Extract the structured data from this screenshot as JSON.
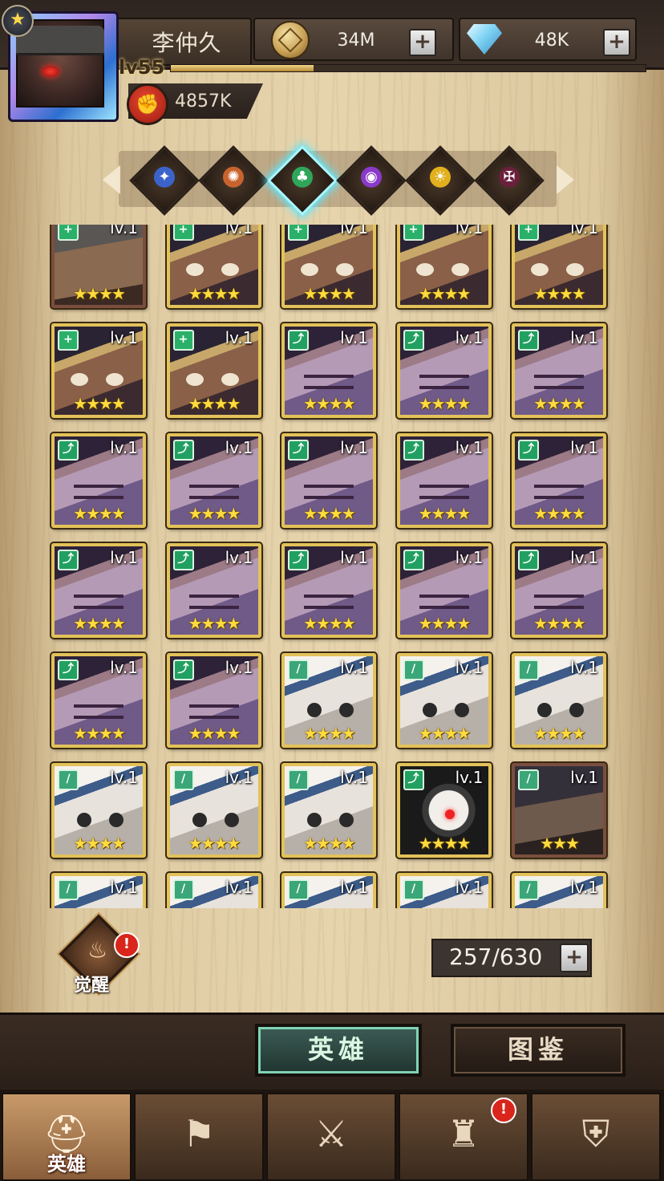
{
  "player": {
    "name": "李仲久",
    "level": "lv55",
    "xp_fraction": 0.3,
    "power": "4857K"
  },
  "currency": {
    "gold": "34M",
    "gems": "48K",
    "plus_symbol": "+"
  },
  "element_filters": [
    {
      "name": "light",
      "color": "#3b63c9",
      "glyph": "✦"
    },
    {
      "name": "fire",
      "color": "#c9632e",
      "glyph": "✺"
    },
    {
      "name": "nature",
      "color": "#2fa65a",
      "glyph": "♣",
      "active": true
    },
    {
      "name": "shadow",
      "color": "#8a3ac9",
      "glyph": "◉"
    },
    {
      "name": "sun",
      "color": "#e2b01e",
      "glyph": "☀"
    },
    {
      "name": "dark",
      "color": "#6a1f3a",
      "glyph": "✠"
    }
  ],
  "heroes": [
    {
      "portrait": "helmet",
      "class": "support",
      "level": "lv.1",
      "stars": "★★★★",
      "quality": "bronze"
    },
    {
      "portrait": "horn",
      "class": "support",
      "level": "lv.1",
      "stars": "★★★★"
    },
    {
      "portrait": "horn",
      "class": "support",
      "level": "lv.1",
      "stars": "★★★★"
    },
    {
      "portrait": "horn",
      "class": "support",
      "level": "lv.1",
      "stars": "★★★★"
    },
    {
      "portrait": "horn",
      "class": "support",
      "level": "lv.1",
      "stars": "★★★★"
    },
    {
      "portrait": "horn",
      "class": "support",
      "level": "lv.1",
      "stars": "★★★★"
    },
    {
      "portrait": "horn",
      "class": "support",
      "level": "lv.1",
      "stars": "★★★★"
    },
    {
      "portrait": "purple",
      "class": "ranger",
      "level": "lv.1",
      "stars": "★★★★"
    },
    {
      "portrait": "purple",
      "class": "ranger",
      "level": "lv.1",
      "stars": "★★★★"
    },
    {
      "portrait": "purple",
      "class": "ranger",
      "level": "lv.1",
      "stars": "★★★★"
    },
    {
      "portrait": "purple",
      "class": "ranger",
      "level": "lv.1",
      "stars": "★★★★"
    },
    {
      "portrait": "purple",
      "class": "ranger",
      "level": "lv.1",
      "stars": "★★★★"
    },
    {
      "portrait": "purple",
      "class": "ranger",
      "level": "lv.1",
      "stars": "★★★★"
    },
    {
      "portrait": "purple",
      "class": "ranger",
      "level": "lv.1",
      "stars": "★★★★"
    },
    {
      "portrait": "purple",
      "class": "ranger",
      "level": "lv.1",
      "stars": "★★★★"
    },
    {
      "portrait": "purple",
      "class": "ranger",
      "level": "lv.1",
      "stars": "★★★★"
    },
    {
      "portrait": "purple",
      "class": "ranger",
      "level": "lv.1",
      "stars": "★★★★"
    },
    {
      "portrait": "purple",
      "class": "ranger",
      "level": "lv.1",
      "stars": "★★★★"
    },
    {
      "portrait": "purple",
      "class": "ranger",
      "level": "lv.1",
      "stars": "★★★★"
    },
    {
      "portrait": "purple",
      "class": "ranger",
      "level": "lv.1",
      "stars": "★★★★"
    },
    {
      "portrait": "purple",
      "class": "ranger",
      "level": "lv.1",
      "stars": "★★★★"
    },
    {
      "portrait": "purple",
      "class": "ranger",
      "level": "lv.1",
      "stars": "★★★★"
    },
    {
      "portrait": "white",
      "class": "rogue",
      "level": "lv.1",
      "stars": "★★★★"
    },
    {
      "portrait": "white",
      "class": "rogue",
      "level": "lv.1",
      "stars": "★★★★"
    },
    {
      "portrait": "white",
      "class": "rogue",
      "level": "lv.1",
      "stars": "★★★★"
    },
    {
      "portrait": "white",
      "class": "rogue",
      "level": "lv.1",
      "stars": "★★★★"
    },
    {
      "portrait": "white",
      "class": "rogue",
      "level": "lv.1",
      "stars": "★★★★"
    },
    {
      "portrait": "white",
      "class": "rogue",
      "level": "lv.1",
      "stars": "★★★★"
    },
    {
      "portrait": "skull",
      "class": "ranger",
      "level": "lv.1",
      "stars": "★★★★"
    },
    {
      "portrait": "hood",
      "class": "rogue",
      "level": "lv.1",
      "stars": "★★★",
      "quality": "bronze"
    },
    {
      "portrait": "white",
      "class": "rogue",
      "level": "lv.1",
      "stars": ""
    },
    {
      "portrait": "white",
      "class": "rogue",
      "level": "lv.1",
      "stars": ""
    },
    {
      "portrait": "white",
      "class": "rogue",
      "level": "lv.1",
      "stars": ""
    },
    {
      "portrait": "white",
      "class": "rogue",
      "level": "lv.1",
      "stars": ""
    },
    {
      "portrait": "white",
      "class": "rogue",
      "level": "lv.1",
      "stars": ""
    }
  ],
  "awaken": {
    "label": "觉醒",
    "alert": "!"
  },
  "capacity": {
    "text": "257/630"
  },
  "tabs": {
    "heroes": "英雄",
    "codex": "图鉴"
  },
  "bottom_nav": [
    {
      "name": "heroes",
      "label": "英雄",
      "icon": "helmet-icon",
      "glyph": "⛑",
      "active": true
    },
    {
      "name": "adventure",
      "label": "",
      "icon": "map-flag-icon",
      "glyph": "⚑"
    },
    {
      "name": "battle",
      "label": "",
      "icon": "crossed-swords-icon",
      "glyph": "⚔"
    },
    {
      "name": "castle",
      "label": "",
      "icon": "tower-icon",
      "glyph": "♜",
      "alert": "!"
    },
    {
      "name": "guild",
      "label": "",
      "icon": "handshake-shield-icon",
      "glyph": "⛨"
    }
  ]
}
